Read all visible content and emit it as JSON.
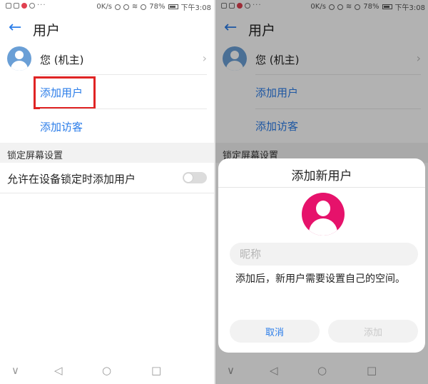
{
  "status_bar": {
    "speed": "0K/s",
    "battery_percent": "78%",
    "time": "下午3:08",
    "more": "···"
  },
  "header": {
    "title": "用户"
  },
  "users": {
    "owner_label": "您 (机主)",
    "add_user": "添加用户",
    "add_guest": "添加访客"
  },
  "lock_screen": {
    "section_title": "锁定屏幕设置",
    "toggle_label": "允许在设备锁定时添加用户"
  },
  "dialog": {
    "title": "添加新用户",
    "nickname_placeholder": "昵称",
    "message": "添加后，新用户需要设置自己的空间。",
    "cancel_label": "取消",
    "add_label": "添加"
  },
  "nav": {
    "collapse": "∨",
    "back": "◁",
    "home": "○",
    "recent": "□"
  },
  "colors": {
    "accent": "#2b7de9",
    "highlight": "#e02424",
    "avatar_owner": "#6a9fd6",
    "avatar_new": "#e6126b"
  },
  "icons": {
    "back": "arrow-left-icon",
    "chevron": "chevron-right-icon",
    "wifi": "wifi-icon",
    "battery": "battery-icon",
    "alarm": "alarm-icon"
  }
}
